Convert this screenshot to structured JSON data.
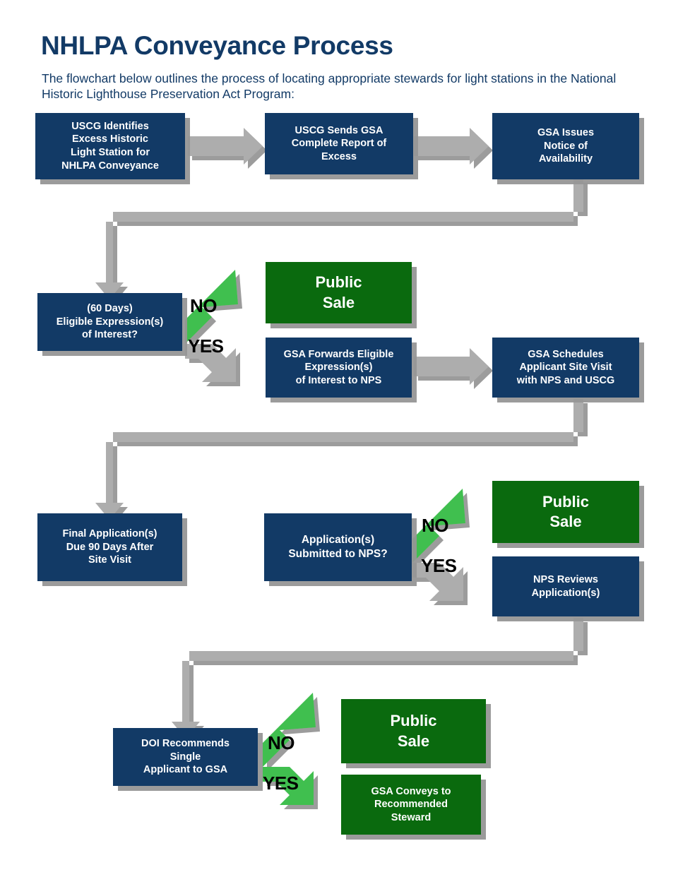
{
  "header": {
    "title": "NHLPA Conveyance Process",
    "subtitle": "The flowchart below outlines the process of locating appropriate stewards for light stations in the National Historic Lighthouse Preservation Act Program:"
  },
  "colors": {
    "navy": "#123a66",
    "green_box": "#0a6a0e",
    "green_arrow": "#3fbf4f",
    "gray_arrow": "#adadad",
    "shadow": "#969696",
    "text_on_box": "#ffffff",
    "title_text": "#123a66"
  },
  "chart_data": {
    "type": "diagram",
    "title": "NHLPA Conveyance Process",
    "nodes": [
      {
        "id": "n1",
        "label": "USCG Identifies\nExcess Historic\nLight Station for\nNHLPA Conveyance",
        "kind": "process",
        "color": "navy"
      },
      {
        "id": "n2",
        "label": "USCG Sends GSA\nComplete Report of\nExcess",
        "kind": "process",
        "color": "navy"
      },
      {
        "id": "n3",
        "label": "GSA Issues\nNotice of\nAvailability",
        "kind": "process",
        "color": "navy"
      },
      {
        "id": "n4",
        "label": "(60 Days)\nEligible Expression(s)\nof Interest?",
        "kind": "decision",
        "color": "navy"
      },
      {
        "id": "n5",
        "label": "Public\nSale",
        "kind": "terminal",
        "color": "green"
      },
      {
        "id": "n6",
        "label": "GSA Forwards Eligible\nExpression(s)\nof Interest to NPS",
        "kind": "process",
        "color": "navy"
      },
      {
        "id": "n7",
        "label": "GSA Schedules\nApplicant Site Visit\nwith NPS and USCG",
        "kind": "process",
        "color": "navy"
      },
      {
        "id": "n8",
        "label": "Final Application(s)\nDue 90 Days After\nSite Visit",
        "kind": "process",
        "color": "navy"
      },
      {
        "id": "n9",
        "label": "Application(s)\nSubmitted to NPS?",
        "kind": "decision",
        "color": "navy"
      },
      {
        "id": "n10",
        "label": "Public\nSale",
        "kind": "terminal",
        "color": "green"
      },
      {
        "id": "n11",
        "label": "NPS Reviews\nApplication(s)",
        "kind": "process",
        "color": "navy"
      },
      {
        "id": "n12",
        "label": "DOI Recommends\nSingle\nApplicant to GSA",
        "kind": "decision",
        "color": "navy"
      },
      {
        "id": "n13",
        "label": "Public\nSale",
        "kind": "terminal",
        "color": "green"
      },
      {
        "id": "n14",
        "label": "GSA Conveys to\nRecommended\nSteward",
        "kind": "terminal",
        "color": "green"
      }
    ],
    "edges": [
      {
        "from": "n1",
        "to": "n2",
        "label": "",
        "style": "gray"
      },
      {
        "from": "n2",
        "to": "n3",
        "label": "",
        "style": "gray"
      },
      {
        "from": "n3",
        "to": "n4",
        "label": "",
        "style": "gray"
      },
      {
        "from": "n4",
        "to": "n5",
        "label": "NO",
        "style": "green"
      },
      {
        "from": "n4",
        "to": "n6",
        "label": "YES",
        "style": "gray"
      },
      {
        "from": "n6",
        "to": "n7",
        "label": "",
        "style": "gray"
      },
      {
        "from": "n7",
        "to": "n8",
        "label": "",
        "style": "gray"
      },
      {
        "from": "n8",
        "to": "n9",
        "label": "",
        "style": "gray"
      },
      {
        "from": "n9",
        "to": "n10",
        "label": "NO",
        "style": "green"
      },
      {
        "from": "n9",
        "to": "n11",
        "label": "YES",
        "style": "gray"
      },
      {
        "from": "n11",
        "to": "n12",
        "label": "",
        "style": "gray"
      },
      {
        "from": "n12",
        "to": "n13",
        "label": "NO",
        "style": "green"
      },
      {
        "from": "n12",
        "to": "n14",
        "label": "YES",
        "style": "green"
      }
    ]
  },
  "branch_labels": {
    "row2_no": "NO",
    "row2_yes": "YES",
    "row3_no": "NO",
    "row3_yes": "YES",
    "row4_no": "NO",
    "row4_yes": "YES"
  },
  "boxes": {
    "n1": "USCG Identifies Excess Historic Light Station for NHLPA Conveyance",
    "n2": "USCG Sends GSA Complete Report of Excess",
    "n3": "GSA Issues Notice of Availability",
    "n4": "(60 Days) Eligible Expression(s) of Interest?",
    "n5": "Public Sale",
    "n6": "GSA Forwards Eligible Expression(s) of Interest to NPS",
    "n7": "GSA Schedules Applicant Site Visit with NPS and USCG",
    "n8": "Final Application(s) Due 90 Days After Site Visit",
    "n9": "Application(s) Submitted to NPS?",
    "n10": "Public Sale",
    "n11": "NPS Reviews Application(s)",
    "n12": "DOI Recommends Single Applicant to GSA",
    "n13": "Public Sale",
    "n14": "GSA Conveys to Recommended Steward"
  },
  "box_lines": {
    "n1": [
      "USCG Identifies",
      "Excess Historic",
      "Light Station for",
      "NHLPA Conveyance"
    ],
    "n2": [
      "USCG Sends GSA",
      "Complete Report of",
      "Excess"
    ],
    "n3": [
      "GSA Issues",
      "Notice of",
      "Availability"
    ],
    "n4": [
      "(60 Days)",
      "Eligible Expression(s)",
      "of Interest?"
    ],
    "n5": [
      "Public",
      "Sale"
    ],
    "n6": [
      "GSA Forwards Eligible",
      "Expression(s)",
      "of Interest to NPS"
    ],
    "n7": [
      "GSA Schedules",
      "Applicant Site Visit",
      "with NPS and USCG"
    ],
    "n8": [
      "Final Application(s)",
      "Due 90 Days After",
      "Site Visit"
    ],
    "n9": [
      "Application(s)",
      "Submitted to NPS?"
    ],
    "n10": [
      "Public",
      "Sale"
    ],
    "n11": [
      "NPS Reviews",
      "Application(s)"
    ],
    "n12": [
      "DOI Recommends",
      "Single",
      "Applicant to GSA"
    ],
    "n13": [
      "Public",
      "Sale"
    ],
    "n14": [
      "GSA Conveys to",
      "Recommended",
      "Steward"
    ]
  }
}
